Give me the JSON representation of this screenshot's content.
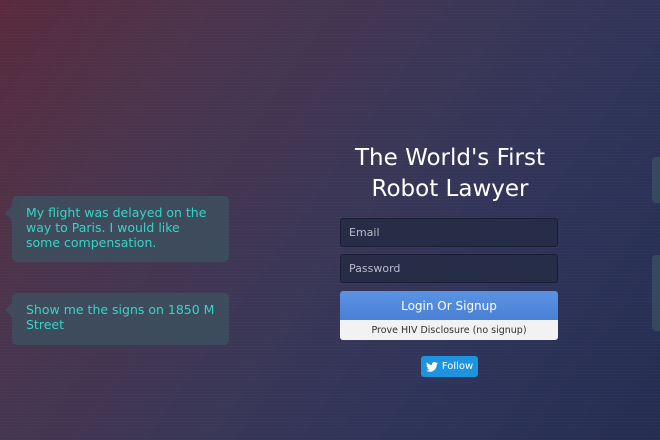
{
  "chat": {
    "messages": [
      {
        "text": "My flight was delayed on the way to Paris. I would like some compensation."
      },
      {
        "text": "Show me the signs on 1850 M Street"
      }
    ]
  },
  "hero": {
    "title": "The World's First Robot Lawyer"
  },
  "form": {
    "email_placeholder": "Email",
    "password_placeholder": "Password",
    "login_label": "Login Or Signup",
    "hiv_label": "Prove HIV Disclosure (no signup)"
  },
  "social": {
    "follow_label": "Follow",
    "follow_icon": "twitter-bird-icon"
  },
  "colors": {
    "bubble_text": "#35d5c5",
    "login_button": "#5b93e3",
    "follow_button": "#1e93de"
  }
}
